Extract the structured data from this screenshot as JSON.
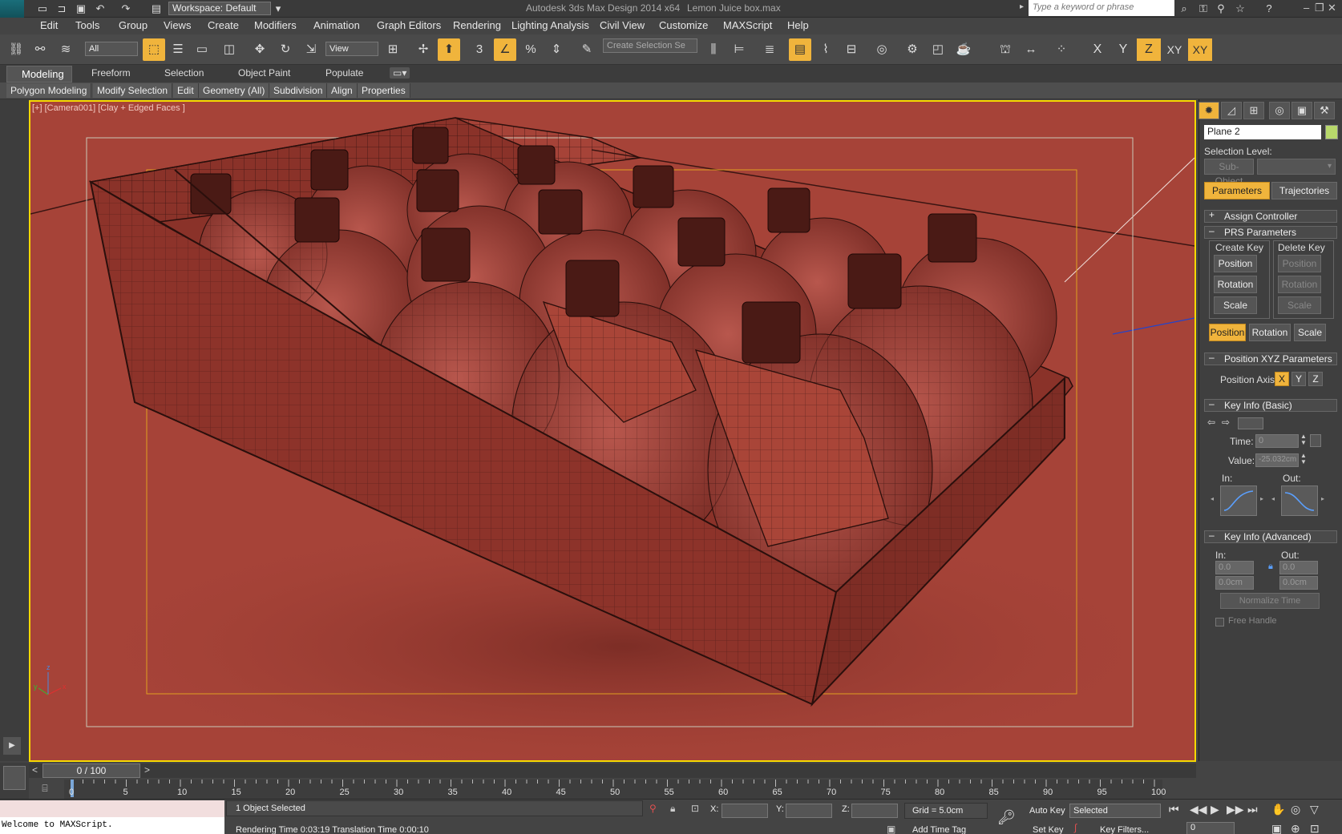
{
  "titlebar": {
    "logo_text": "MXD",
    "workspace": "Workspace: Default",
    "app_title": "Autodesk 3ds Max Design 2014 x64",
    "file_title": "Lemon Juice box.max",
    "search_placeholder": "Type a keyword or phrase"
  },
  "menu": [
    "Edit",
    "Tools",
    "Group",
    "Views",
    "Create",
    "Modifiers",
    "Animation",
    "Graph Editors",
    "Rendering",
    "Lighting Analysis",
    "Civil View",
    "Customize",
    "MAXScript",
    "Help"
  ],
  "toolbar": {
    "selection_filter": "All",
    "reference_coord": "View",
    "selection_set_placeholder": "Create Selection Se",
    "axis_x": "X",
    "axis_y": "Y",
    "axis_z": "Z",
    "axis_xy": "XY",
    "axis_xy2": "XY"
  },
  "ribbon": {
    "tabs": [
      "Modeling",
      "Freeform",
      "Selection",
      "Object Paint",
      "Populate"
    ],
    "panels": [
      "Polygon Modeling",
      "Modify Selection",
      "Edit",
      "Geometry (All)",
      "Subdivision",
      "Align",
      "Properties"
    ]
  },
  "viewport": {
    "label": "[+] [Camera001] [Clay + Edged Faces ]",
    "background_color": "#a64338",
    "border_color": "#f5d800"
  },
  "command_panel": {
    "object_name": "Plane 2",
    "selection_level_label": "Selection Level:",
    "sub_object": "Sub-Object",
    "tab_parameters": "Parameters",
    "tab_trajectories": "Trajectories",
    "assign_controller": "Assign Controller",
    "prs_parameters": "PRS Parameters",
    "create_key": "Create Key",
    "delete_key": "Delete Key",
    "create_position": "Position",
    "create_rotation": "Rotation",
    "create_scale": "Scale",
    "delete_position": "Position",
    "delete_rotation": "Rotation",
    "delete_scale": "Scale",
    "mode_position": "Position",
    "mode_rotation": "Rotation",
    "mode_scale": "Scale",
    "position_xyz_parameters": "Position XYZ Parameters",
    "position_axis_label": "Position Axis:",
    "axis_x": "X",
    "axis_y": "Y",
    "axis_z": "Z",
    "key_info_basic": "Key Info (Basic)",
    "time_label": "Time:",
    "time_value": "0",
    "value_label": "Value:",
    "value_value": "-25.032cm",
    "in_label": "In:",
    "out_label": "Out:",
    "key_info_advanced": "Key Info (Advanced)",
    "adv_in_label": "In:",
    "adv_out_label": "Out:",
    "adv_in_value": "0.0",
    "adv_out_value": "0.0",
    "adv_in_cm": "0.0cm",
    "adv_out_cm": "0.0cm",
    "normalize_time": "Normalize Time",
    "free_handle": "Free Handle"
  },
  "timeline": {
    "frame_display": "0 / 100",
    "prev": "<",
    "next": ">",
    "ticks": [
      "0",
      "5",
      "10",
      "15",
      "20",
      "25",
      "30",
      "35",
      "40",
      "45",
      "50",
      "55",
      "60",
      "65",
      "70",
      "75",
      "80",
      "85",
      "90",
      "95",
      "100"
    ]
  },
  "status": {
    "maxscript_output": "Welcome to MAXScript.",
    "selection": "1 Object Selected",
    "render_info": "Rendering Time  0:03:19     Translation Time  0:00:10",
    "x_label": "X:",
    "y_label": "Y:",
    "z_label": "Z:",
    "grid": "Grid = 5.0cm",
    "auto_key": "Auto Key",
    "set_key": "Set Key",
    "key_mode": "Selected",
    "key_filters": "Key Filters...",
    "add_time_tag": "Add Time Tag",
    "current_frame": "0"
  }
}
